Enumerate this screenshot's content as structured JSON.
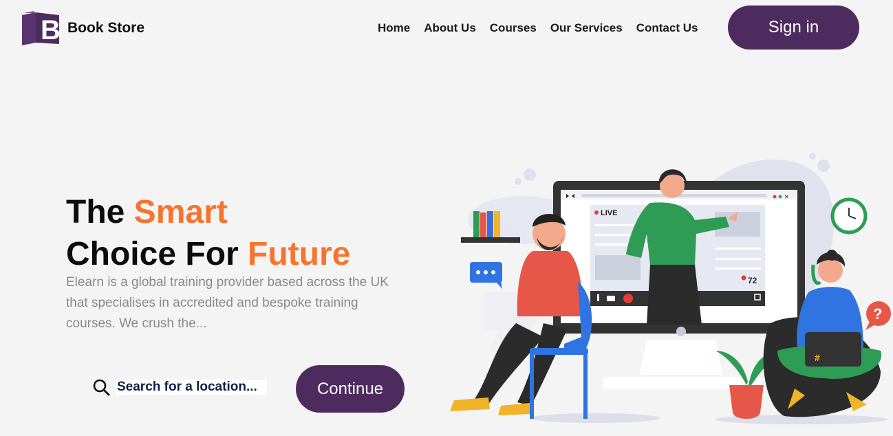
{
  "brand": {
    "name": "Book Store",
    "accent_color": "#4d2b5e",
    "logo_letter": "B"
  },
  "nav": {
    "items": [
      "Home",
      "About Us",
      "Courses",
      "Our Services",
      "Contact Us"
    ]
  },
  "header": {
    "signin_label": "Sign in"
  },
  "hero": {
    "title_line1_a": "The ",
    "title_line1_b": "Smart",
    "title_line2_a": "Choice For ",
    "title_line2_b": "Future",
    "highlight_color": "#f6742e",
    "description": "Elearn is a global training provider based across the UK that specialises in accredited and bespoke training courses. We crush the..."
  },
  "search": {
    "placeholder": "Search for a location...",
    "icon": "search-icon"
  },
  "cta": {
    "continue_label": "Continue"
  },
  "illustration": {
    "live_label": "LIVE",
    "viewer_count": "72"
  }
}
